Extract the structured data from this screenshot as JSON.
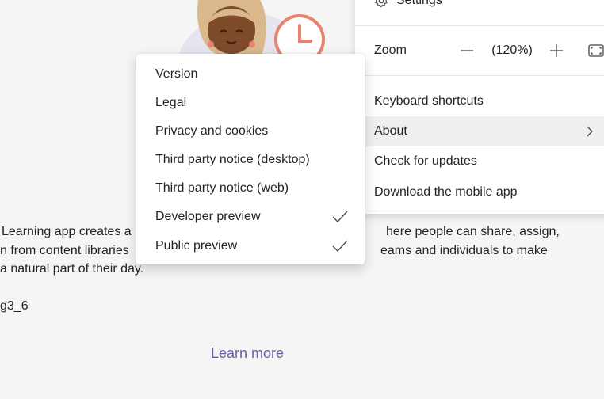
{
  "background": {
    "description_lines": [
      "Learning app creates a",
      "here people can share, assign,",
      "n from content libraries",
      "eams and individuals to make",
      "a natural part of their day."
    ],
    "app_id": "g3_6",
    "learn_more": "Learn more"
  },
  "settings_menu": {
    "settings_label": "Settings",
    "zoom_label": "Zoom",
    "zoom_value": "(120%)",
    "items": [
      {
        "label": "Keyboard shortcuts"
      },
      {
        "label": "About"
      },
      {
        "label": "Check for updates"
      },
      {
        "label": "Download the mobile app"
      }
    ]
  },
  "about_submenu": {
    "items": [
      {
        "label": "Version"
      },
      {
        "label": "Legal"
      },
      {
        "label": "Privacy and cookies"
      },
      {
        "label": "Third party notice (desktop)"
      },
      {
        "label": "Third party notice (web)"
      },
      {
        "label": "Developer preview",
        "checked": true
      },
      {
        "label": "Public preview",
        "checked": true
      }
    ]
  },
  "colors": {
    "link": "#6264a7",
    "clock": "#e8826f",
    "hover_row": "#f0efef"
  },
  "icons": [
    "gear-icon",
    "minus-icon",
    "plus-icon",
    "fullscreen-icon",
    "chevron-right-icon",
    "checkmark-icon"
  ]
}
